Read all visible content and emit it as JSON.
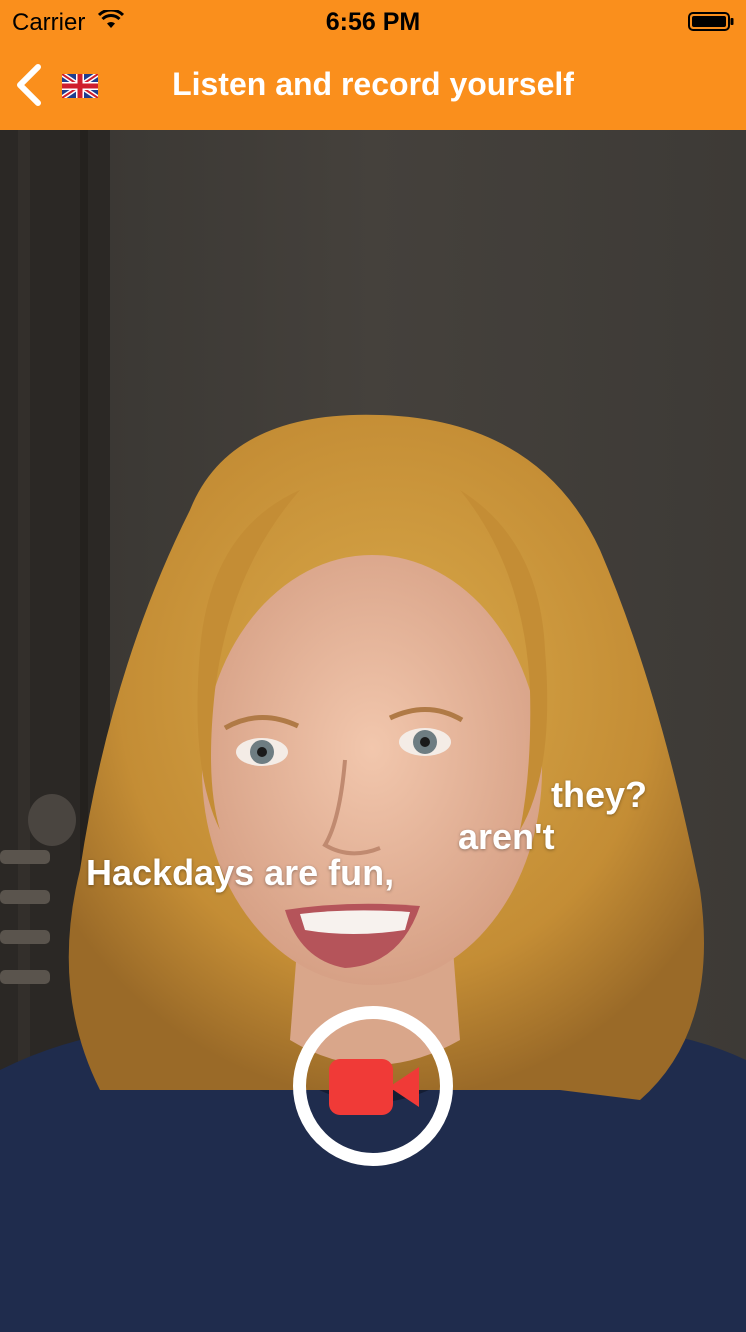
{
  "status_bar": {
    "carrier": "Carrier",
    "time": "6:56 PM"
  },
  "nav": {
    "title": "Listen and record yourself",
    "back_icon": "chevron-left-icon",
    "flag_icon": "uk-flag-icon"
  },
  "subtitles": {
    "word1": "Hackdays are fun,",
    "word2": "aren't",
    "word3": "they?"
  },
  "record_button": {
    "icon": "video-camera-icon",
    "icon_color": "#f03a37"
  },
  "colors": {
    "header": "#fa8f1c",
    "title_text": "#ffffff"
  }
}
